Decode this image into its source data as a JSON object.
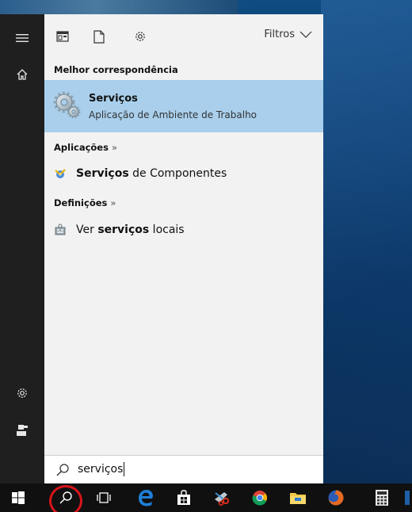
{
  "panel": {
    "filters_label": "Filtros",
    "best_match_heading": "Melhor correspondência",
    "best_match": {
      "title": "Serviços",
      "subtitle": "Aplicação de Ambiente de Trabalho"
    },
    "apps_heading": "Aplicações",
    "apps_arrow": "»",
    "apps": [
      {
        "bold": "Serviços",
        "rest": " de Componentes"
      }
    ],
    "settings_heading": "Definições",
    "settings_arrow": "»",
    "settings": [
      {
        "prefix": "Ver ",
        "bold": "serviços",
        "rest": " locais"
      }
    ]
  },
  "search": {
    "query": "serviços"
  },
  "colors": {
    "panel_bg": "#f2f2f2",
    "selected_bg": "#a9cfec",
    "rail_bg": "#1f1f1f",
    "taskbar_bg": "#101010",
    "highlight_ring": "#d8141b",
    "edge_blue": "#1e7fd8"
  },
  "icons": {
    "rail": [
      "hamburger-icon",
      "home-icon",
      "settings-gear-icon",
      "user-icon"
    ],
    "filters": [
      "apps-filter-icon",
      "documents-filter-icon",
      "settings-filter-icon",
      "chevron-down-icon"
    ],
    "taskbar": [
      "windows-start-icon",
      "search-icon",
      "task-view-icon",
      "edge-icon",
      "store-icon",
      "snipping-tool-icon",
      "chrome-icon",
      "file-explorer-icon",
      "firefox-icon",
      "calculator-icon"
    ]
  }
}
